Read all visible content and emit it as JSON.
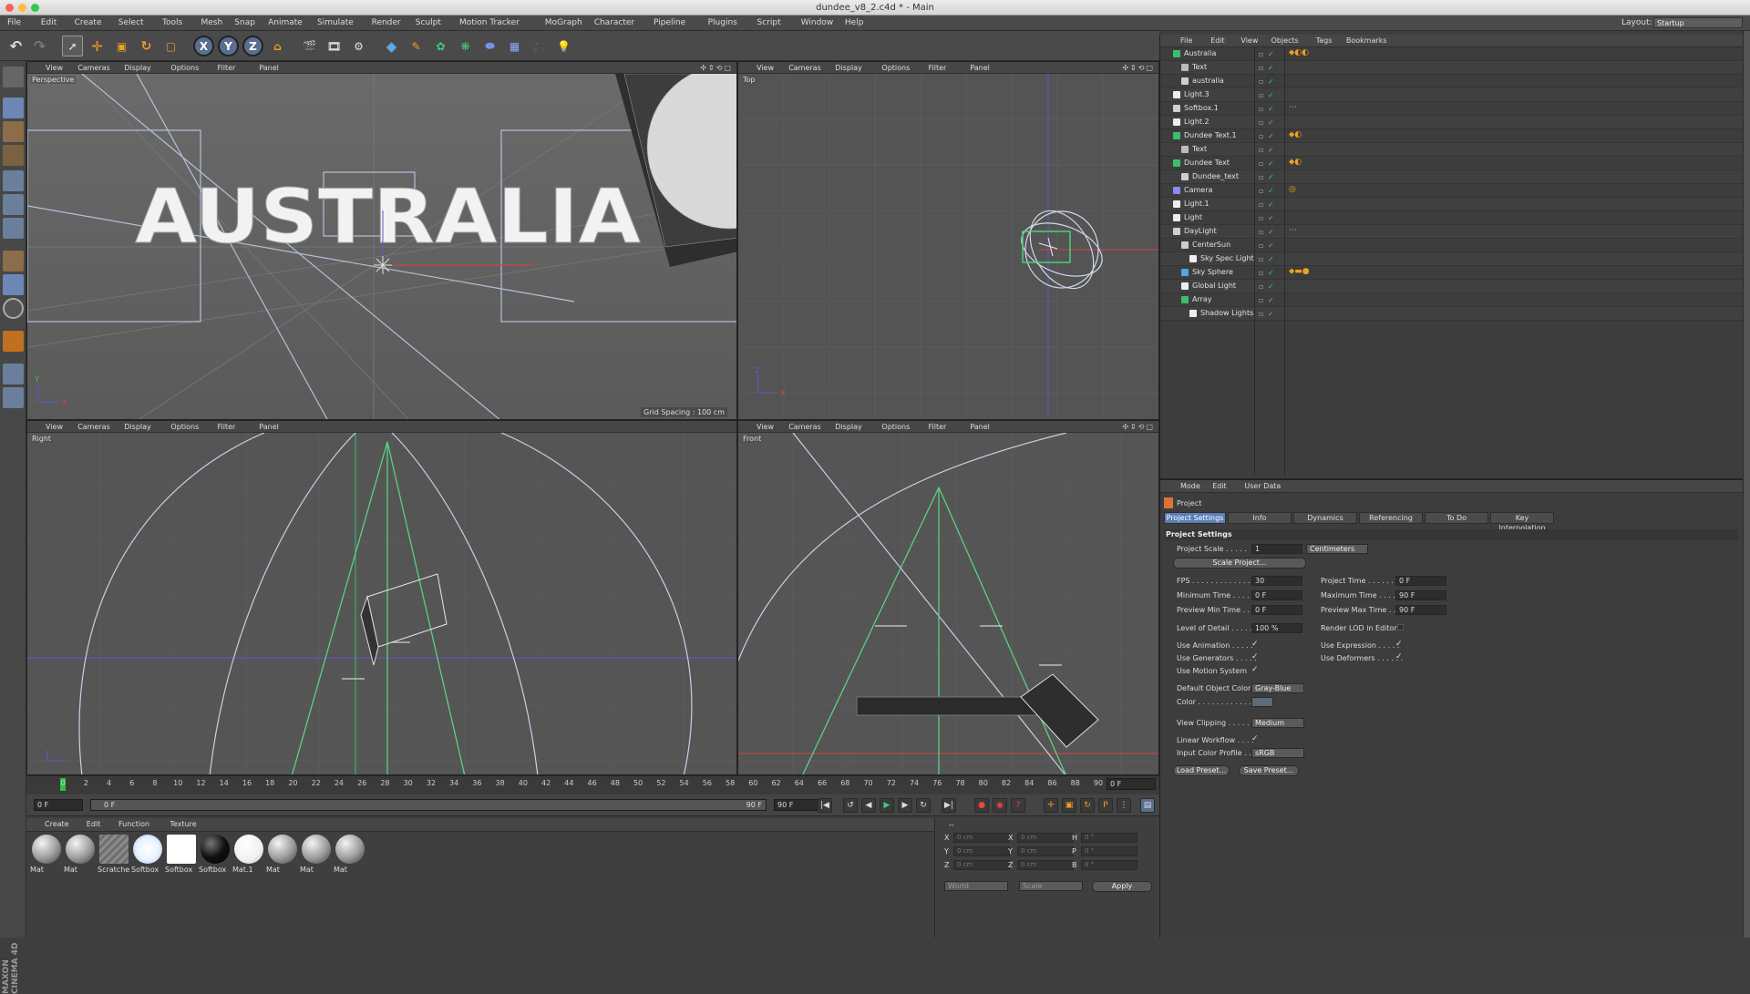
{
  "window": {
    "title": "dundee_v8_2.c4d * - Main"
  },
  "menu": [
    "File",
    "Edit",
    "Create",
    "Select",
    "Tools",
    "Mesh",
    "Snap",
    "Animate",
    "Simulate",
    "Render",
    "Sculpt",
    "Motion Tracker",
    "MoGraph",
    "Character",
    "Pipeline",
    "Plugins",
    "Script",
    "Window",
    "Help"
  ],
  "layout": {
    "label": "Layout:",
    "value": "Startup"
  },
  "toolbar": {
    "x": "X",
    "y": "Y",
    "z": "Z"
  },
  "viewport_menu": [
    "View",
    "Cameras",
    "Display",
    "Options",
    "Filter",
    "Panel"
  ],
  "viewports": {
    "perspective": "Perspective",
    "top": "Top",
    "right": "Right",
    "front": "Front",
    "grid_spacing": "Grid Spacing : 100 cm",
    "scene_text": "AUSTRALIA"
  },
  "axes": {
    "x": "X",
    "y": "Y",
    "z": "Z"
  },
  "timeline": {
    "ticks": [
      "0",
      "2",
      "4",
      "6",
      "8",
      "10",
      "12",
      "14",
      "16",
      "18",
      "20",
      "22",
      "24",
      "26",
      "28",
      "30",
      "32",
      "34",
      "36",
      "38",
      "40",
      "42",
      "44",
      "46",
      "48",
      "50",
      "52",
      "54",
      "56",
      "58",
      "60",
      "62",
      "64",
      "66",
      "68",
      "70",
      "72",
      "74",
      "76",
      "78",
      "80",
      "82",
      "84",
      "86",
      "88",
      "90"
    ],
    "current": "0 F",
    "start": "0 F",
    "range_start": "0 F",
    "range_end": "90 F",
    "end": "90 F"
  },
  "material_menu": [
    "Create",
    "Edit",
    "Function",
    "Texture"
  ],
  "materials": [
    {
      "name": "Mat",
      "style": "gray"
    },
    {
      "name": "Mat",
      "style": "gray"
    },
    {
      "name": "Scratche",
      "style": "scratch"
    },
    {
      "name": "Softbox",
      "style": "softbox"
    },
    {
      "name": "Softbox",
      "style": "white-square"
    },
    {
      "name": "Softbox",
      "style": "black"
    },
    {
      "name": "Mat.1",
      "style": "white"
    },
    {
      "name": "Mat",
      "style": "gray"
    },
    {
      "name": "Mat",
      "style": "gray"
    },
    {
      "name": "Mat",
      "style": "gray"
    }
  ],
  "coords": {
    "header": "--",
    "rows": [
      {
        "a": "X",
        "av": "0 cm",
        "b": "X",
        "bv": "0 cm",
        "c": "H",
        "cv": "0 °"
      },
      {
        "a": "Y",
        "av": "0 cm",
        "b": "Y",
        "bv": "0 cm",
        "c": "P",
        "cv": "0 °"
      },
      {
        "a": "Z",
        "av": "0 cm",
        "b": "Z",
        "bv": "0 cm",
        "c": "B",
        "cv": "0 °"
      }
    ],
    "world": "World",
    "scale": "Scale",
    "apply": "Apply"
  },
  "object_manager": {
    "menu": [
      "File",
      "Edit",
      "View",
      "Objects",
      "Tags",
      "Bookmarks"
    ],
    "objects": [
      {
        "name": "Australia",
        "indent": 0,
        "icon": "#3cbf6a"
      },
      {
        "name": "Text",
        "indent": 1,
        "icon": "#bbb"
      },
      {
        "name": "australia",
        "indent": 1,
        "icon": "#cfcfcf"
      },
      {
        "name": "Light.3",
        "indent": 0,
        "icon": "#eee"
      },
      {
        "name": "Softbox.1",
        "indent": 0,
        "icon": "#cfcfcf"
      },
      {
        "name": "Light.2",
        "indent": 0,
        "icon": "#eee"
      },
      {
        "name": "Dundee Text.1",
        "indent": 0,
        "icon": "#3cbf6a"
      },
      {
        "name": "Text",
        "indent": 1,
        "icon": "#bbb"
      },
      {
        "name": "Dundee Text",
        "indent": 0,
        "icon": "#3cbf6a"
      },
      {
        "name": "Dundee_text",
        "indent": 1,
        "icon": "#cfcfcf"
      },
      {
        "name": "Camera",
        "indent": 0,
        "icon": "#8a8af0"
      },
      {
        "name": "Light.1",
        "indent": 0,
        "icon": "#eee"
      },
      {
        "name": "Light",
        "indent": 0,
        "icon": "#eee"
      },
      {
        "name": "DayLight",
        "indent": 0,
        "icon": "#cfcfcf"
      },
      {
        "name": "CenterSun",
        "indent": 1,
        "icon": "#cfcfcf"
      },
      {
        "name": "Sky Spec Light",
        "indent": 2,
        "icon": "#eee"
      },
      {
        "name": "Sky Sphere",
        "indent": 1,
        "icon": "#4fa8e0"
      },
      {
        "name": "Global Light",
        "indent": 1,
        "icon": "#eee"
      },
      {
        "name": "Array",
        "indent": 1,
        "icon": "#3cbf6a"
      },
      {
        "name": "Shadow Lights",
        "indent": 2,
        "icon": "#eee"
      }
    ]
  },
  "attributes": {
    "menu": [
      "Mode",
      "Edit",
      "User Data"
    ],
    "object": "Project",
    "tabs": [
      "Project Settings",
      "Info",
      "Dynamics",
      "Referencing",
      "To Do",
      "Key Interpolation"
    ],
    "section": "Project Settings",
    "project_scale_label": "Project Scale . . . . .",
    "project_scale_value": "1",
    "project_scale_unit": "Centimeters",
    "scale_project": "Scale Project...",
    "fps_label": "FPS . . . . . . . . . . . . .",
    "fps": "30",
    "project_time_label": "Project Time . . . . . . .",
    "project_time": "0 F",
    "min_time_label": "Minimum Time . . . . .",
    "min_time": "0 F",
    "max_time_label": "Maximum Time . . . . .",
    "max_time": "90 F",
    "prev_min_label": "Preview Min Time . .",
    "prev_min": "0 F",
    "prev_max_label": "Preview Max Time . .",
    "prev_max": "90 F",
    "lod_label": "Level of Detail . . . . .",
    "lod": "100 %",
    "render_lod_label": "Render LOD in Editor",
    "use_anim_label": "Use Animation . . . . .",
    "use_expr_label": "Use Expression . . . . .",
    "use_gen_label": "Use Generators . . . . .",
    "use_def_label": "Use Deformers . . . . . .",
    "use_motion_label": "Use Motion System",
    "def_color_label": "Default Object Color",
    "def_color": "Gray-Blue",
    "color_label": "Color . . . . . . . . . . . . .",
    "view_clip_label": "View Clipping . . . . . .",
    "view_clip": "Medium",
    "linear_label": "Linear Workflow . . . .",
    "icp_label": "Input Color Profile . .",
    "icp": "sRGB",
    "load_preset": "Load Preset...",
    "save_preset": "Save Preset...",
    "check": "✓"
  }
}
